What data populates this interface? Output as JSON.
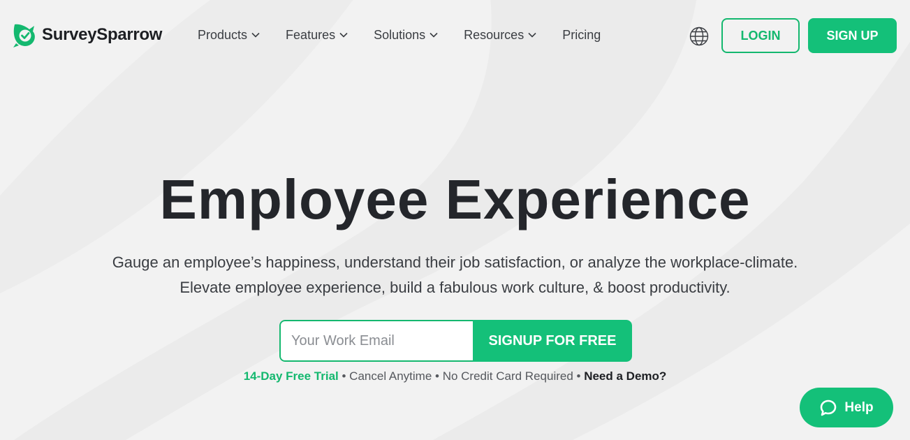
{
  "brand": {
    "name": "SurveySparrow",
    "accent": "#14c079",
    "text_dark": "#24262b"
  },
  "nav": {
    "items": [
      {
        "label": "Products",
        "has_dropdown": true
      },
      {
        "label": "Features",
        "has_dropdown": true
      },
      {
        "label": "Solutions",
        "has_dropdown": true
      },
      {
        "label": "Resources",
        "has_dropdown": true
      },
      {
        "label": "Pricing",
        "has_dropdown": false
      }
    ],
    "globe_icon": "globe-icon",
    "login_label": "LOGIN",
    "signup_label": "SIGN UP"
  },
  "hero": {
    "title": "Employee Experience",
    "subtitle_line1": "Gauge an employee’s happiness, understand their job satisfaction, or analyze the workplace-climate.",
    "subtitle_line2": "Elevate employee experience, build a fabulous work culture, & boost productivity.",
    "email_placeholder": "Your Work Email",
    "email_value": "",
    "cta_label": "SIGNUP FOR FREE"
  },
  "trial": {
    "free_trial": "14-Day Free Trial",
    "sep": " • ",
    "cancel": "Cancel Anytime",
    "no_card": "No Credit Card Required",
    "demo": "Need a Demo?"
  },
  "help": {
    "label": "Help",
    "icon": "chat-bubble-icon"
  }
}
